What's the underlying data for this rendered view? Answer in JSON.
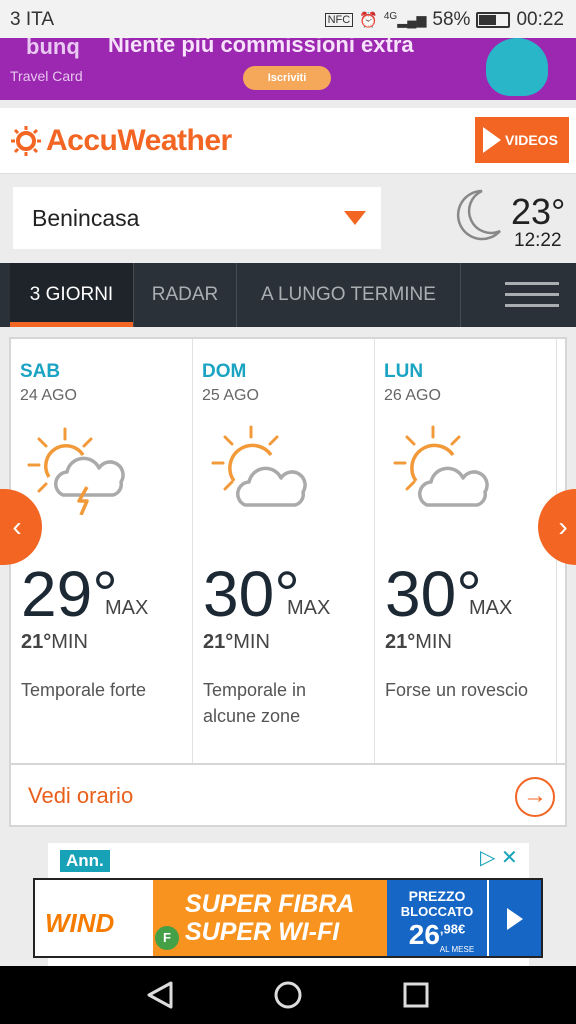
{
  "status_bar": {
    "carrier": "3 ITA",
    "nfc": "NFC",
    "network": "4G",
    "battery": "58%",
    "battery_level": 0.58,
    "time": "00:22"
  },
  "ad_top": {
    "brand": "bunq",
    "card": "Travel Card",
    "headline": "Niente più commissioni extra",
    "cta": "Iscriviti"
  },
  "header": {
    "logo": "AccuWeather",
    "videos_label": "VIDEOS"
  },
  "location": {
    "name": "Benincasa",
    "current_temp": "23°",
    "current_time": "12:22",
    "condition_icon": "moon-icon"
  },
  "tabs": [
    {
      "label": "3 GIORNI",
      "active": true
    },
    {
      "label": "RADAR",
      "active": false
    },
    {
      "label": "A LUNGO TERMINE",
      "active": false
    }
  ],
  "forecast": [
    {
      "day": "SAB",
      "date": "24 AGO",
      "max": "29°",
      "max_label": "MAX",
      "min": "21°",
      "min_label": "MIN",
      "condition": "Temporale forte",
      "icon": "thunderstorm-icon"
    },
    {
      "day": "DOM",
      "date": "25 AGO",
      "max": "30°",
      "max_label": "MAX",
      "min": "21°",
      "min_label": "MIN",
      "condition": "Temporale in alcune zone",
      "icon": "partly-cloudy-icon"
    },
    {
      "day": "LUN",
      "date": "26 AGO",
      "max": "30°",
      "max_label": "MAX",
      "min": "21°",
      "min_label": "MIN",
      "condition": "Forse un rovescio",
      "icon": "partly-cloudy-icon"
    }
  ],
  "vedi_orario": "Vedi orario",
  "ad_bottom": {
    "label": "Ann.",
    "brand": "WIND",
    "line1": "SUPER FIBRA",
    "line2": "SUPER WI-FI",
    "price_title": "PREZZO",
    "price_sub": "BLOCCATO",
    "price_int": "26",
    "price_dec": ",98€",
    "price_unit": "AL MESE",
    "badge": "F"
  },
  "colors": {
    "accent": "#f26522",
    "nav_bg": "#2b3138",
    "day_name": "#1aa3c2",
    "ad_purple": "#9c27b0"
  }
}
